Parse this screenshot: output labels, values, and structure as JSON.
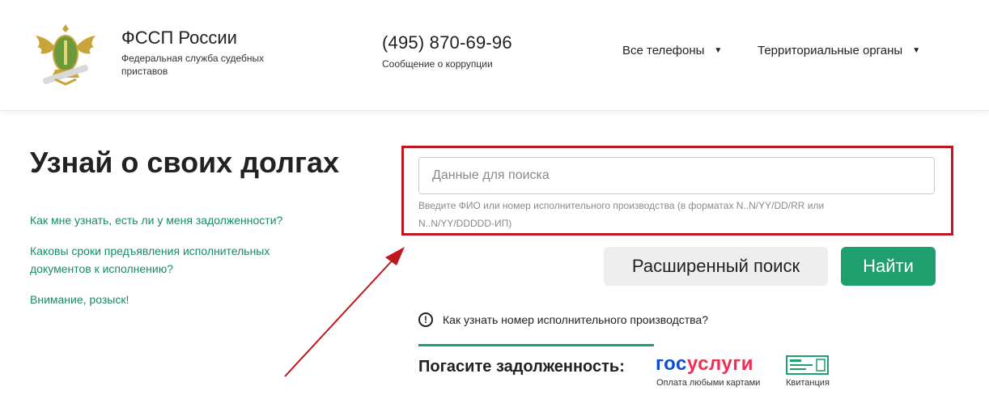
{
  "header": {
    "org_name": "ФССП России",
    "org_desc": "Федеральная служба судебных приставов",
    "phone": "(495) 870-69-96",
    "phone_sub": "Сообщение о коррупции",
    "all_phones": "Все телефоны",
    "territorial": "Территориальные органы"
  },
  "main": {
    "title": "Узнай о своих долгах",
    "links": [
      "Как мне узнать, есть ли у меня задолженности?",
      "Каковы сроки предъявления исполнительных документов к исполнению?",
      "Внимание, розыск!"
    ],
    "search": {
      "placeholder": "Данные для поиска",
      "value": "",
      "hint": "Введите ФИО или номер исполнительного производства (в форматах N..N/YY/DD/RR или N..N/YY/DDDDD-ИП)"
    },
    "advanced_button": "Расширенный поиск",
    "find_button": "Найти",
    "info_icon": "!",
    "info_link": "Как узнать номер исполнительного производства?",
    "pay_label": "Погасите задолженность:",
    "gosuslugi": {
      "part1": "гос",
      "part2": "услуги",
      "sub": "Оплата любыми картами"
    },
    "receipt_label": "Квитанция"
  },
  "colors": {
    "accent": "#1f9e6e",
    "link": "#1a8a5e",
    "highlight": "#c0161f",
    "gos_blue": "#0d4cd3",
    "gos_red": "#ee2f53"
  },
  "icons": {
    "emblem": "fssp-emblem-icon",
    "caret": "caret-down-icon",
    "info": "info-circle-icon",
    "receipt": "receipt-icon",
    "arrow": "annotation-arrow-icon"
  }
}
